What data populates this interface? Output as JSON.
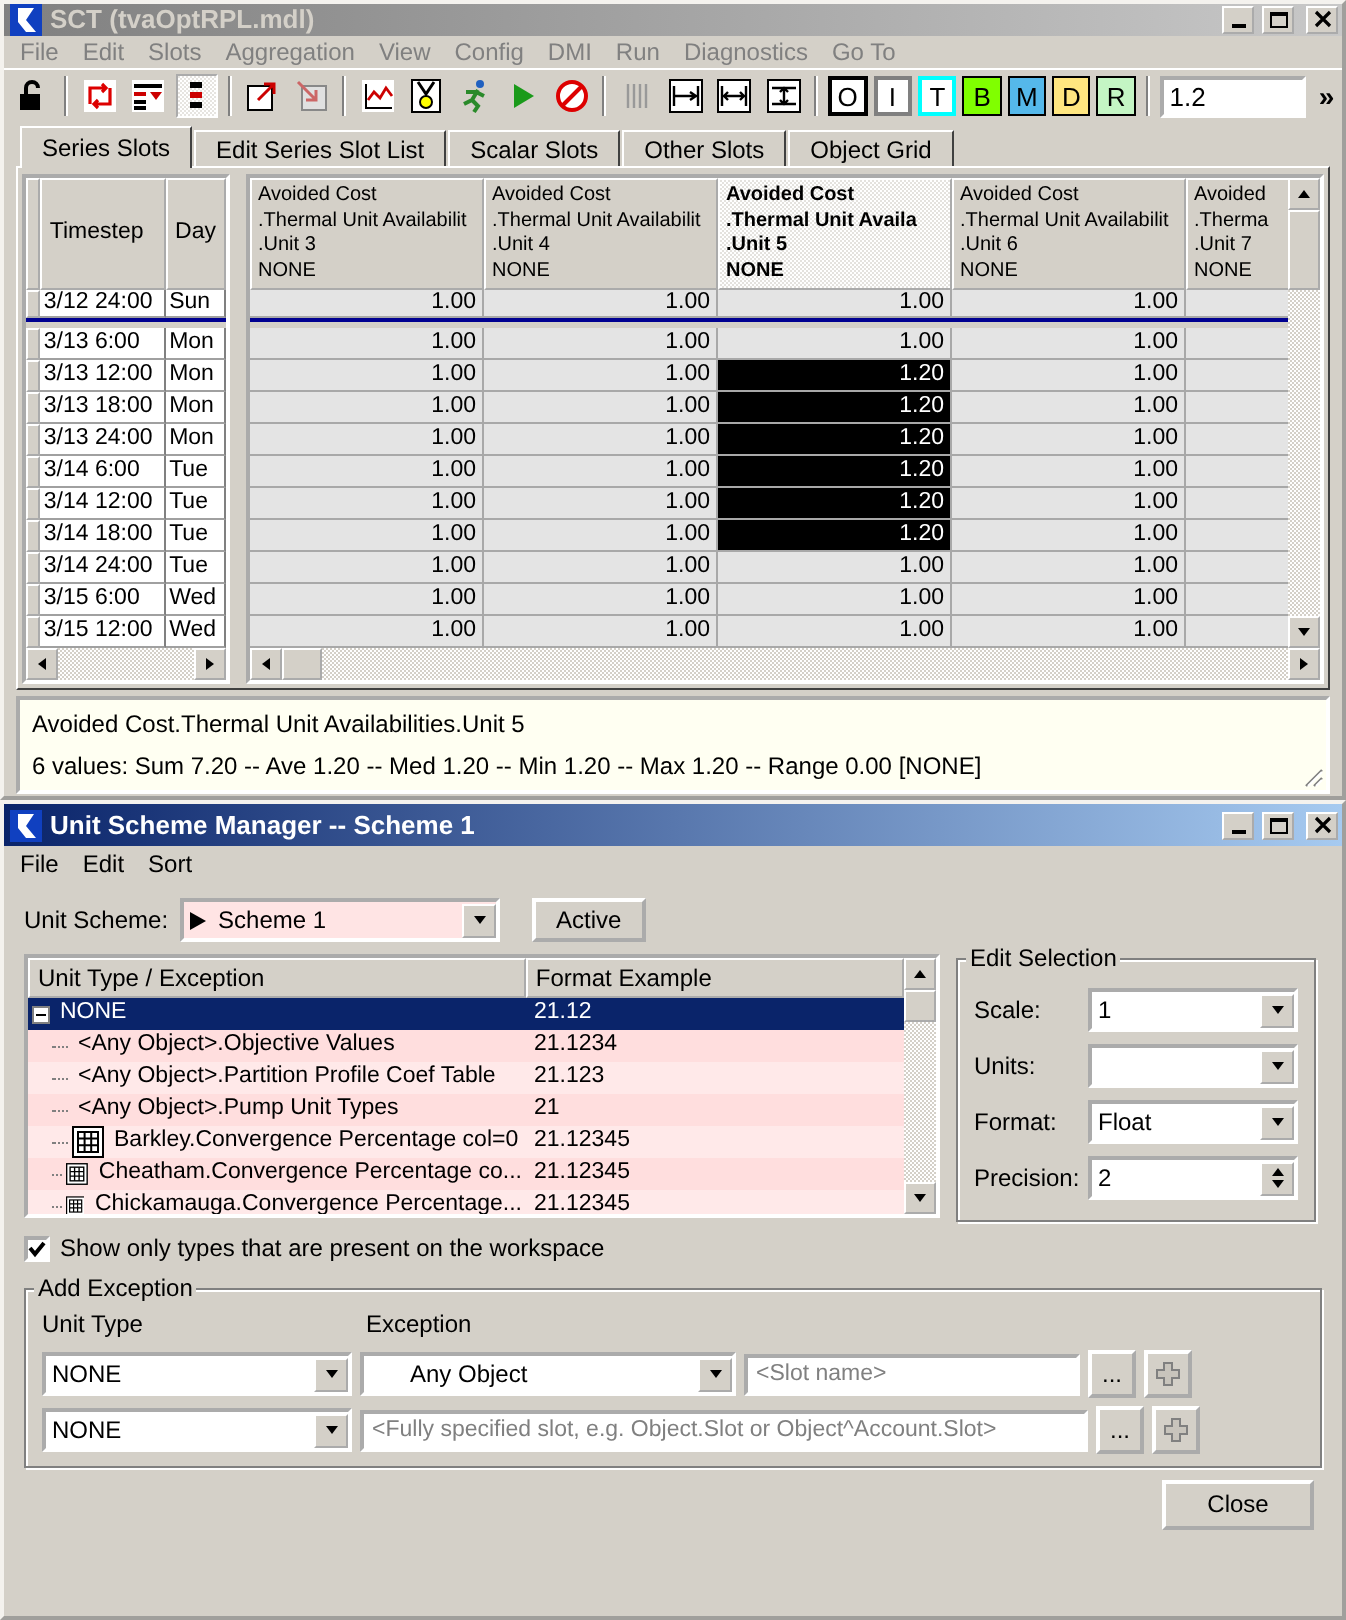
{
  "sct_window": {
    "title": "SCT  (tvaOptRPL.mdl)",
    "active": false,
    "menu": [
      "File",
      "Edit",
      "Slots",
      "Aggregation",
      "View",
      "Config",
      "DMI",
      "Run",
      "Diagnostics",
      "Go To"
    ],
    "toolbar": {
      "letter_buttons": [
        {
          "kind": "outline",
          "label": "O",
          "color": "#000000"
        },
        {
          "kind": "outline",
          "label": "I",
          "color": "#808080"
        },
        {
          "kind": "outline",
          "label": "T",
          "color": "#00ffff"
        },
        {
          "kind": "fill",
          "label": "B",
          "color": "#80ff00"
        },
        {
          "kind": "fill",
          "label": "M",
          "color": "#55b8ea"
        },
        {
          "kind": "fill",
          "label": "D",
          "color": "#ffe680"
        },
        {
          "kind": "fill",
          "label": "R",
          "color": "#c4f5c4"
        }
      ],
      "value": "1.2",
      "overflow": "»"
    },
    "tabs": [
      {
        "label": "Series Slots",
        "selected": true
      },
      {
        "label": "Edit Series Slot List",
        "selected": false
      },
      {
        "label": "Scalar Slots",
        "selected": false
      },
      {
        "label": "Other Slots",
        "selected": false
      },
      {
        "label": "Object Grid",
        "selected": false
      }
    ],
    "table": {
      "frozen_columns": [
        "Timestep",
        "Day"
      ],
      "columns": [
        {
          "lines": [
            "Avoided Cost",
            ".Thermal Unit Availabilit",
            ".Unit 3",
            "NONE"
          ],
          "selected": false
        },
        {
          "lines": [
            "Avoided Cost",
            ".Thermal Unit Availabilit",
            ".Unit 4",
            "NONE"
          ],
          "selected": false
        },
        {
          "lines": [
            "Avoided Cost",
            ".Thermal Unit Availa",
            ".Unit 5",
            "NONE"
          ],
          "selected": true
        },
        {
          "lines": [
            "Avoided Cost",
            ".Thermal Unit Availabilit",
            ".Unit 6",
            "NONE"
          ],
          "selected": false
        },
        {
          "lines": [
            "Avoided",
            ".Therma",
            ".Unit 7",
            "NONE"
          ],
          "selected": false
        }
      ],
      "rows": [
        {
          "kind": "initial",
          "timestep": "3/12 24:00",
          "day": "Sun",
          "cells": [
            {
              "value": "1.00",
              "selected": false
            },
            {
              "value": "1.00",
              "selected": false
            },
            {
              "value": "1.00",
              "selected": false
            },
            {
              "value": "1.00",
              "selected": false
            }
          ]
        },
        {
          "kind": "run",
          "timestep": "3/13 6:00",
          "day": "Mon",
          "cells": [
            {
              "value": "1.00",
              "selected": false
            },
            {
              "value": "1.00",
              "selected": false
            },
            {
              "value": "1.00",
              "selected": false
            },
            {
              "value": "1.00",
              "selected": false
            }
          ]
        },
        {
          "kind": "run",
          "timestep": "3/13 12:00",
          "day": "Mon",
          "cells": [
            {
              "value": "1.00",
              "selected": false
            },
            {
              "value": "1.00",
              "selected": false
            },
            {
              "value": "1.20",
              "selected": true
            },
            {
              "value": "1.00",
              "selected": false
            }
          ]
        },
        {
          "kind": "run",
          "timestep": "3/13 18:00",
          "day": "Mon",
          "cells": [
            {
              "value": "1.00",
              "selected": false
            },
            {
              "value": "1.00",
              "selected": false
            },
            {
              "value": "1.20",
              "selected": true
            },
            {
              "value": "1.00",
              "selected": false
            }
          ]
        },
        {
          "kind": "run",
          "timestep": "3/13 24:00",
          "day": "Mon",
          "cells": [
            {
              "value": "1.00",
              "selected": false
            },
            {
              "value": "1.00",
              "selected": false
            },
            {
              "value": "1.20",
              "selected": true
            },
            {
              "value": "1.00",
              "selected": false
            }
          ]
        },
        {
          "kind": "run",
          "timestep": "3/14 6:00",
          "day": "Tue",
          "cells": [
            {
              "value": "1.00",
              "selected": false
            },
            {
              "value": "1.00",
              "selected": false
            },
            {
              "value": "1.20",
              "selected": true
            },
            {
              "value": "1.00",
              "selected": false
            }
          ]
        },
        {
          "kind": "run",
          "timestep": "3/14 12:00",
          "day": "Tue",
          "cells": [
            {
              "value": "1.00",
              "selected": false
            },
            {
              "value": "1.00",
              "selected": false
            },
            {
              "value": "1.20",
              "selected": true
            },
            {
              "value": "1.00",
              "selected": false
            }
          ]
        },
        {
          "kind": "run",
          "timestep": "3/14 18:00",
          "day": "Tue",
          "cells": [
            {
              "value": "1.00",
              "selected": false
            },
            {
              "value": "1.00",
              "selected": false
            },
            {
              "value": "1.20",
              "selected": true
            },
            {
              "value": "1.00",
              "selected": false
            }
          ]
        },
        {
          "kind": "run",
          "timestep": "3/14 24:00",
          "day": "Tue",
          "cells": [
            {
              "value": "1.00",
              "selected": false
            },
            {
              "value": "1.00",
              "selected": false
            },
            {
              "value": "1.00",
              "selected": false
            },
            {
              "value": "1.00",
              "selected": false
            }
          ]
        },
        {
          "kind": "run",
          "timestep": "3/15 6:00",
          "day": "Wed",
          "cells": [
            {
              "value": "1.00",
              "selected": false
            },
            {
              "value": "1.00",
              "selected": false
            },
            {
              "value": "1.00",
              "selected": false
            },
            {
              "value": "1.00",
              "selected": false
            }
          ]
        },
        {
          "kind": "run",
          "timestep": "3/15 12:00",
          "day": "Wed",
          "cells": [
            {
              "value": "1.00",
              "selected": false
            },
            {
              "value": "1.00",
              "selected": false
            },
            {
              "value": "1.00",
              "selected": false
            },
            {
              "value": "1.00",
              "selected": false
            }
          ]
        }
      ]
    },
    "status": {
      "slot": "Avoided Cost.Thermal Unit Availabilities.Unit 5",
      "summary": "6 values:  Sum 7.20 -- Ave 1.20 -- Med 1.20 -- Min 1.20 -- Max 1.20 -- Range 0.00 [NONE]"
    }
  },
  "unit_scheme_window": {
    "title": "Unit Scheme Manager -- Scheme 1",
    "active": true,
    "menu": [
      "File",
      "Edit",
      "Sort"
    ],
    "scheme": {
      "label": "Unit Scheme:",
      "value": "Scheme 1",
      "button": "Active"
    },
    "tree": {
      "columns": [
        "Unit Type / Exception",
        "Format Example"
      ],
      "rows": [
        {
          "label": "NONE",
          "format": "21.12",
          "selected": true,
          "expanded": true,
          "children": [
            {
              "kind": "any",
              "label": "<Any Object>.Objective Values",
              "format": "21.1234",
              "selected": false
            },
            {
              "kind": "any",
              "label": "<Any Object>.Partition Profile Coef Table",
              "format": "21.123",
              "selected": false
            },
            {
              "kind": "any",
              "label": "<Any Object>.Pump Unit Types",
              "format": "21",
              "selected": false
            },
            {
              "kind": "slot",
              "label": "Barkley.Convergence Percentage col=0",
              "format": "21.12345",
              "selected": false
            },
            {
              "kind": "slot",
              "label": "Cheatham.Convergence Percentage co...",
              "format": "21.12345",
              "selected": false
            },
            {
              "kind": "slot",
              "label": "Chickamauga.Convergence Percentage...",
              "format": "21.12345",
              "selected": false
            }
          ]
        }
      ]
    },
    "edit_selection": {
      "title": "Edit Selection",
      "fields": [
        {
          "kind": "dropdown",
          "label": "Scale:",
          "value": "1"
        },
        {
          "kind": "dropdown",
          "label": "Units:"
        },
        {
          "kind": "dropdown",
          "label": "Format:",
          "value": "Float"
        },
        {
          "kind": "spinner",
          "label": "Precision:",
          "value": "2"
        }
      ]
    },
    "show_only_present": {
      "label": "Show only types that are present on the workspace",
      "checked": true
    },
    "add_exception": {
      "title": "Add Exception",
      "headings": [
        "Unit Type",
        "Exception"
      ],
      "rows": [
        {
          "unit_type": "NONE",
          "exception": "Any Object",
          "placeholder": "<Slot name>",
          "browse": "..."
        },
        {
          "unit_type": "NONE",
          "placeholder": "<Fully specified slot, e.g. Object.Slot or Object^Account.Slot>",
          "browse": "..."
        }
      ]
    },
    "close_button": "Close"
  }
}
